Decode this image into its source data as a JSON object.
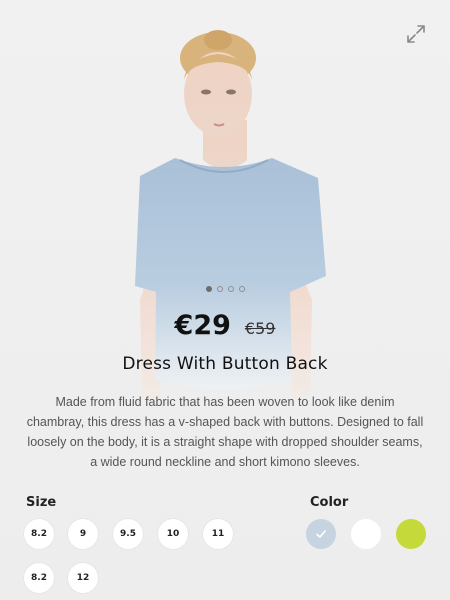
{
  "product": {
    "price": "€29",
    "old_price": "€59",
    "title": "Dress With Button Back",
    "description": "Made from fluid fabric that has been woven to look like denim chambray, this dress has a v-shaped back with buttons. Designed to fall loosely on the body, it is a straight shape with dropped shoulder seams, a wide round neckline and short kimono sleeves."
  },
  "gallery": {
    "image_count": 4,
    "active_index": 0
  },
  "size": {
    "label": "Size",
    "options": [
      "8.2",
      "9",
      "9.5",
      "10",
      "11",
      "8.2",
      "12"
    ]
  },
  "color": {
    "label": "Color",
    "options": [
      {
        "color": "#c6d4e2",
        "selected": true
      },
      {
        "color": "#ffffff",
        "selected": false
      },
      {
        "color": "#c5d93a",
        "selected": false
      }
    ]
  },
  "icons": {
    "expand": "expand-icon",
    "check": "check-icon"
  }
}
